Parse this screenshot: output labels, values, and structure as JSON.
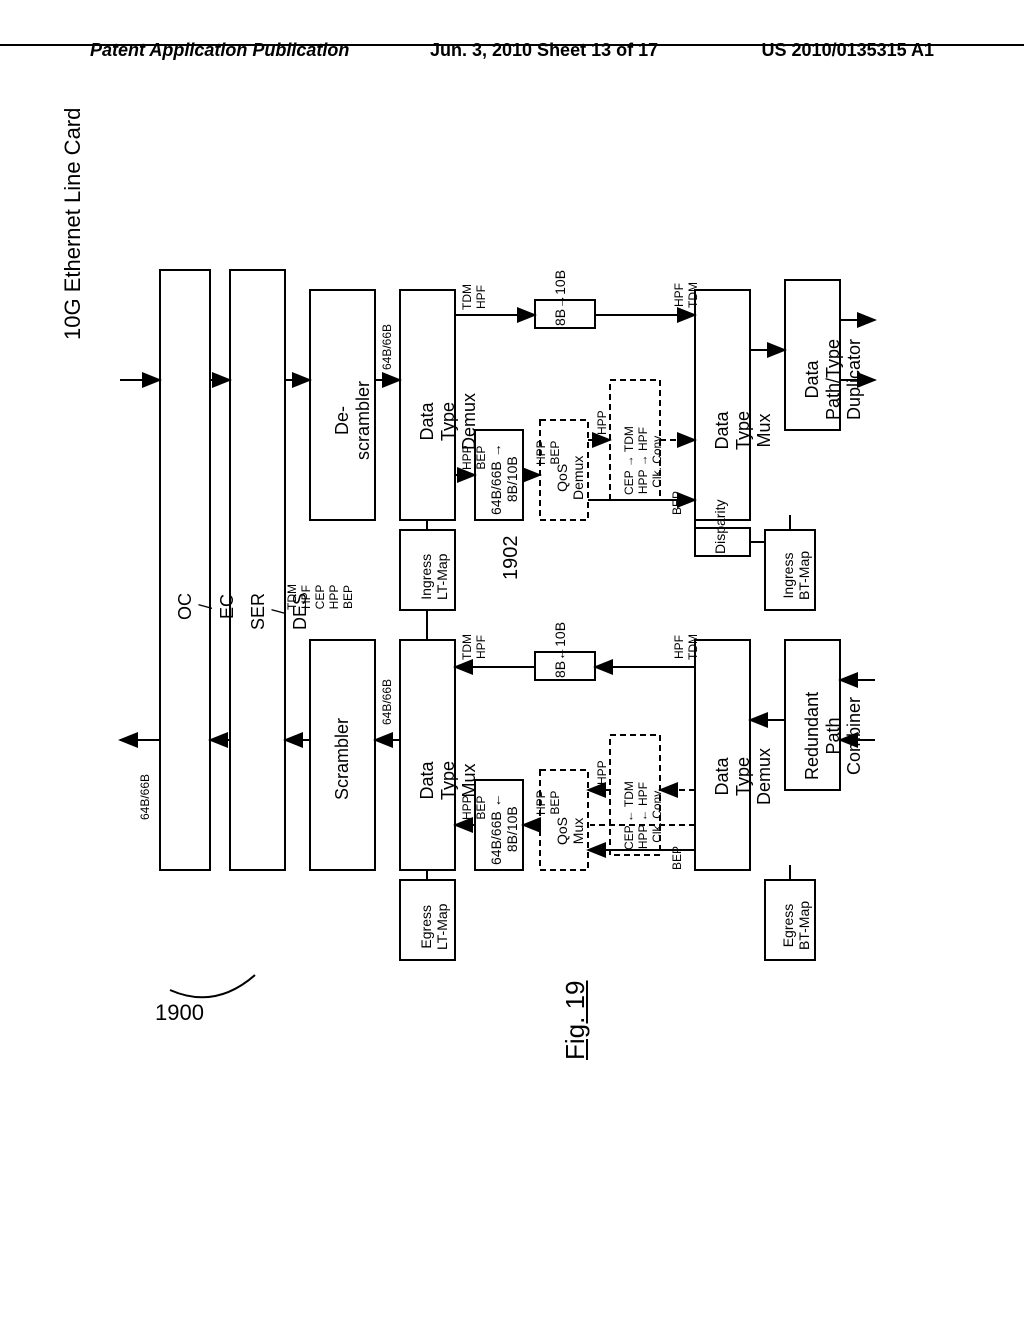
{
  "header": {
    "left": "Patent Application Publication",
    "center": "Jun. 3, 2010  Sheet 13 of 17",
    "right": "US 2010/0135315 A1"
  },
  "title": "10G Ethernet Line Card",
  "figure": "Fig. 19",
  "ref1": "1900",
  "ref2": "1902",
  "blocks": {
    "ocec": "OC\n/\nEC",
    "serdes": "SER\n/\nDES",
    "descram": "De-\nscrambler",
    "scram": "Scrambler",
    "dtdmx_top": "Data\nType\nDemux",
    "dtmx_bot": "Data\nType\nMux",
    "ingress_lt": "Ingress\nLT-Map",
    "egress_lt": "Egress\nLT-Map",
    "b6466_top": "64B/66B →\n8B/10B",
    "b6466_bot": "64B/66B ←\n8B/10B",
    "qos_dmx": "QoS\nDemux",
    "qos_mux": "QoS\nMux",
    "b8b10_top": "8B→10B",
    "b8b10_bot": "8B←10B",
    "conv_top": "CEP → TDM\nHPP → HPF\nClk. Conv.",
    "conv_bot": "CEP ← TDM\nHPP ← HPF\nClk. Conv.",
    "dtmux_top": "Data\nType\nMux",
    "dtdemux_bot": "Data\nType\nDemux",
    "disp": "Disparity",
    "ingress_bt": "Ingress\nBT-Map",
    "egress_bt": "Egress\nBT-Map",
    "dup": "Data\nPath/Type\nDuplicator",
    "comb": "Redundant\nPath\nCombiner"
  },
  "labels": {
    "b64": "64B/66B",
    "labels5": "TDM\nHPF\nCEP\nHPP\nBEP",
    "tdm_hpf": "TDM\nHPF",
    "hpp_bep": "HPP\nBEP",
    "hpp": "HPP",
    "bep": "BEP",
    "hpf_tdm": "HPF\nTDM"
  }
}
